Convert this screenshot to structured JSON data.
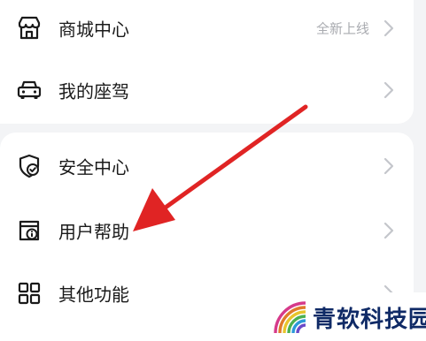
{
  "menu": {
    "group1": [
      {
        "label": "商城中心",
        "hint": "全新上线",
        "icon": "storefront-icon"
      },
      {
        "label": "我的座驾",
        "icon": "car-icon"
      }
    ],
    "group2": [
      {
        "label": "安全中心",
        "icon": "shield-check-icon"
      },
      {
        "label": "用户帮助",
        "icon": "help-info-icon"
      },
      {
        "label": "其他功能",
        "icon": "grid-icon"
      }
    ]
  },
  "colors": {
    "arrow": "#e02424",
    "text": "#1a1a1a",
    "hint": "#a9abb0",
    "chevron": "#c4c6cb"
  },
  "watermark": {
    "text": "青软科技园",
    "icon": "wifi-logo-icon"
  }
}
